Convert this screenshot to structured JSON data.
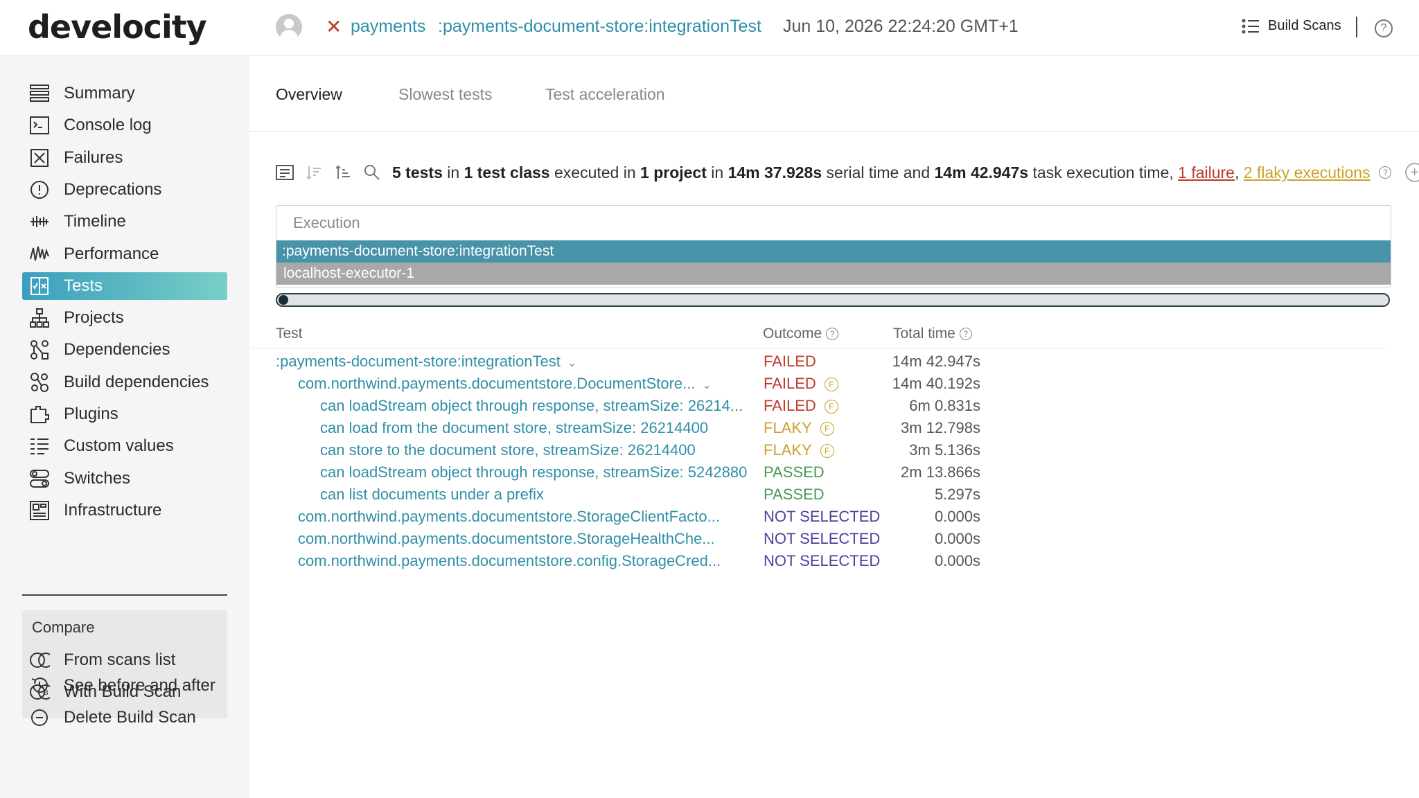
{
  "header": {
    "logo": "develocity",
    "project": "payments",
    "task": ":payments-document-store:integrationTest",
    "date": "Jun 10, 2026 22:24:20 GMT+1",
    "build_scans_label": "Build Scans",
    "status_icon": "close-icon",
    "help_glyph": "?"
  },
  "sidebar": {
    "items": [
      {
        "label": "Summary",
        "icon": "summary-icon"
      },
      {
        "label": "Console log",
        "icon": "console-icon"
      },
      {
        "label": "Failures",
        "icon": "failures-icon"
      },
      {
        "label": "Deprecations",
        "icon": "deprecations-icon"
      },
      {
        "label": "Timeline",
        "icon": "timeline-icon"
      },
      {
        "label": "Performance",
        "icon": "performance-icon"
      },
      {
        "label": "Tests",
        "icon": "tests-icon",
        "active": true
      },
      {
        "label": "Projects",
        "icon": "projects-icon"
      },
      {
        "label": "Dependencies",
        "icon": "dependencies-icon"
      },
      {
        "label": "Build dependencies",
        "icon": "build-dependencies-icon"
      },
      {
        "label": "Plugins",
        "icon": "plugins-icon"
      },
      {
        "label": "Custom values",
        "icon": "custom-values-icon"
      },
      {
        "label": "Switches",
        "icon": "switches-icon"
      },
      {
        "label": "Infrastructure",
        "icon": "infrastructure-icon"
      }
    ],
    "compare": {
      "title": "Compare",
      "items": [
        {
          "label": "From scans list",
          "icon": "venn-icon"
        },
        {
          "label": "With Build Scan",
          "icon": "venn-b-icon"
        }
      ]
    },
    "bottom": [
      {
        "label": "See before and after",
        "icon": "history-icon"
      },
      {
        "label": "Delete Build Scan",
        "icon": "delete-icon"
      }
    ]
  },
  "tabs": [
    {
      "label": "Overview",
      "active": true
    },
    {
      "label": "Slowest tests"
    },
    {
      "label": "Test acceleration"
    }
  ],
  "summary": {
    "n_tests": "5 tests",
    "in1": "in",
    "n_classes": "1 test class",
    "executed_in": "executed in",
    "n_projects": "1 project",
    "in2": "in",
    "serial_time": "14m 37.928s",
    "serial_label": "serial time and",
    "task_time": "14m 42.947s",
    "task_label": "task execution time,",
    "failures": "1 failure",
    "comma": ",",
    "flaky": "2 flaky executions",
    "help_glyph": "?",
    "add_glyph": "+"
  },
  "execution": {
    "label": "Execution",
    "task_bar": ":payments-document-store:integrationTest",
    "executor_bar": "localhost-executor-1"
  },
  "table": {
    "headers": {
      "test": "Test",
      "outcome": "Outcome",
      "time": "Total time",
      "help_glyph": "?"
    },
    "chevron": "⌄",
    "flaky_glyph": "F",
    "rows": [
      {
        "name": ":payments-document-store:integrationTest",
        "level": 0,
        "outcome": "FAILED",
        "kind": "failed",
        "time": "14m 42.947s",
        "chevron": true,
        "flaky": false
      },
      {
        "name": "com.northwind.payments.documentstore.DocumentStore...",
        "level": 1,
        "outcome": "FAILED",
        "kind": "failed",
        "time": "14m 40.192s",
        "chevron": true,
        "flaky": true
      },
      {
        "name": "can loadStream object through response, streamSize: 26214...",
        "level": 2,
        "outcome": "FAILED",
        "kind": "failed",
        "time": "6m 0.831s",
        "chevron": false,
        "flaky": true
      },
      {
        "name": "can load from the document store, streamSize: 26214400",
        "level": 2,
        "outcome": "FLAKY",
        "kind": "flaky",
        "time": "3m 12.798s",
        "chevron": false,
        "flaky": true
      },
      {
        "name": "can store to the document store, streamSize: 26214400",
        "level": 2,
        "outcome": "FLAKY",
        "kind": "flaky",
        "time": "3m 5.136s",
        "chevron": false,
        "flaky": true
      },
      {
        "name": "can loadStream object through response, streamSize: 5242880",
        "level": 2,
        "outcome": "PASSED",
        "kind": "passed",
        "time": "2m 13.866s",
        "chevron": false,
        "flaky": false
      },
      {
        "name": "can list documents under a prefix",
        "level": 2,
        "outcome": "PASSED",
        "kind": "passed",
        "time": "5.297s",
        "chevron": false,
        "flaky": false
      },
      {
        "name": "com.northwind.payments.documentstore.StorageClientFacto...",
        "level": 1,
        "outcome": "NOT SELECTED",
        "kind": "notsel",
        "time": "0.000s",
        "chevron": false,
        "flaky": false
      },
      {
        "name": "com.northwind.payments.documentstore.StorageHealthChe...",
        "level": 1,
        "outcome": "NOT SELECTED",
        "kind": "notsel",
        "time": "0.000s",
        "chevron": false,
        "flaky": false
      },
      {
        "name": "com.northwind.payments.documentstore.config.StorageCred...",
        "level": 1,
        "outcome": "NOT SELECTED",
        "kind": "notsel",
        "time": "0.000s",
        "chevron": false,
        "flaky": false
      }
    ]
  },
  "colors": {
    "accent": "#2f8fa6",
    "failed": "#c0392b",
    "flaky": "#c9a227",
    "passed": "#4a9a55",
    "not_selected": "#4f3f9f"
  }
}
